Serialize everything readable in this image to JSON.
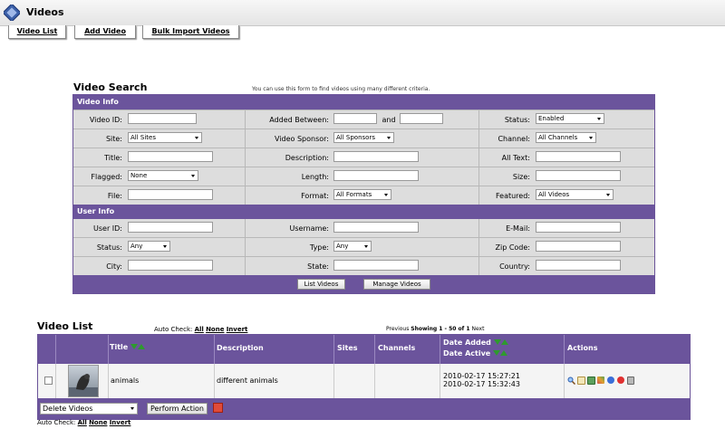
{
  "header": {
    "title": "Videos"
  },
  "tabs": [
    "Video List",
    "Add Video",
    "Bulk Import Videos"
  ],
  "search": {
    "title": "Video Search",
    "note": "You can use this form to find videos using many different criteria.",
    "video_info_label": "Video Info",
    "user_info_label": "User Info",
    "labels": {
      "video_id": "Video ID:",
      "added_between": "Added Between:",
      "and": "and",
      "status": "Status:",
      "site": "Site:",
      "video_sponsor": "Video Sponsor:",
      "channel": "Channel:",
      "title": "Title:",
      "description": "Description:",
      "all_text": "All Text:",
      "flagged": "Flagged:",
      "length": "Length:",
      "size": "Size:",
      "file": "File:",
      "format": "Format:",
      "featured": "Featured:",
      "user_id": "User ID:",
      "username": "Username:",
      "email": "E-Mail:",
      "user_status": "Status:",
      "type": "Type:",
      "zip": "Zip Code:",
      "city": "City:",
      "state": "State:",
      "country": "Country:"
    },
    "selects": {
      "status": "Enabled",
      "site": "All Sites",
      "video_sponsor": "All Sponsors",
      "channel": "All Channels",
      "flagged": "None",
      "format": "All Formats",
      "featured": "All Videos",
      "user_status": "Any",
      "type": "Any"
    },
    "list_videos_btn": "List Videos",
    "manage_videos_btn": "Manage Videos"
  },
  "video_list": {
    "title": "Video List",
    "auto_check_label": "Auto Check:",
    "auto_all": "All",
    "auto_none": "None",
    "auto_invert": "Invert",
    "pager_prev": "Previous",
    "pager_showing": "Showing 1 - 50 of 1",
    "pager_next": "Next",
    "columns": {
      "title": "Title",
      "description": "Description",
      "sites": "Sites",
      "channels": "Channels",
      "date_added": "Date Added",
      "date_active": "Date Active",
      "actions": "Actions"
    },
    "rows": [
      {
        "title": "animals",
        "description": "different animals",
        "date_added": "2010-02-17 15:27:21",
        "date_active": "2010-02-17 15:32:43"
      }
    ],
    "bulk_action": "Delete Videos",
    "perform_action_btn": "Perform Action"
  }
}
